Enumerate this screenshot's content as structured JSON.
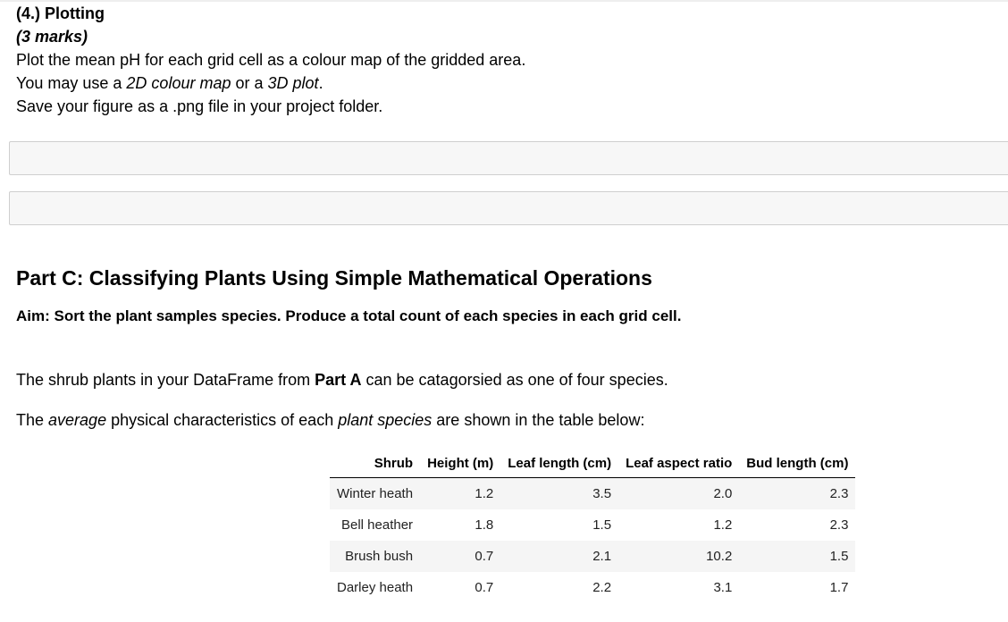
{
  "section4": {
    "heading": "(4.) Plotting",
    "marks": "(3 marks)",
    "line1": "Plot the mean pH for each grid cell as a colour map of the gridded area.",
    "line2_pre": "You may use a ",
    "line2_em1": "2D colour map",
    "line2_mid": " or a ",
    "line2_em2": "3D plot",
    "line2_post": ".",
    "line3": "Save your figure as a .png file in your project folder."
  },
  "partC": {
    "heading": "Part C: Classifying Plants Using Simple Mathematical Operations",
    "aim": "Aim: Sort the plant samples species. Produce a total count of each species in each grid cell.",
    "p1_pre": "The shrub plants in your DataFrame from ",
    "p1_bold": "Part A",
    "p1_post": " can be catagorsied as one of four species.",
    "p2_pre": "The ",
    "p2_em1": "average",
    "p2_mid": " physical characteristics of each ",
    "p2_em2": "plant species",
    "p2_post": " are shown in the table below:"
  },
  "table": {
    "headers": [
      "Shrub",
      "Height (m)",
      "Leaf length (cm)",
      "Leaf aspect ratio",
      "Bud length (cm)"
    ],
    "rows": [
      [
        "Winter heath",
        "1.2",
        "3.5",
        "2.0",
        "2.3"
      ],
      [
        "Bell heather",
        "1.8",
        "1.5",
        "1.2",
        "2.3"
      ],
      [
        "Brush bush",
        "0.7",
        "2.1",
        "10.2",
        "1.5"
      ],
      [
        "Darley heath",
        "0.7",
        "2.2",
        "3.1",
        "1.7"
      ]
    ]
  }
}
